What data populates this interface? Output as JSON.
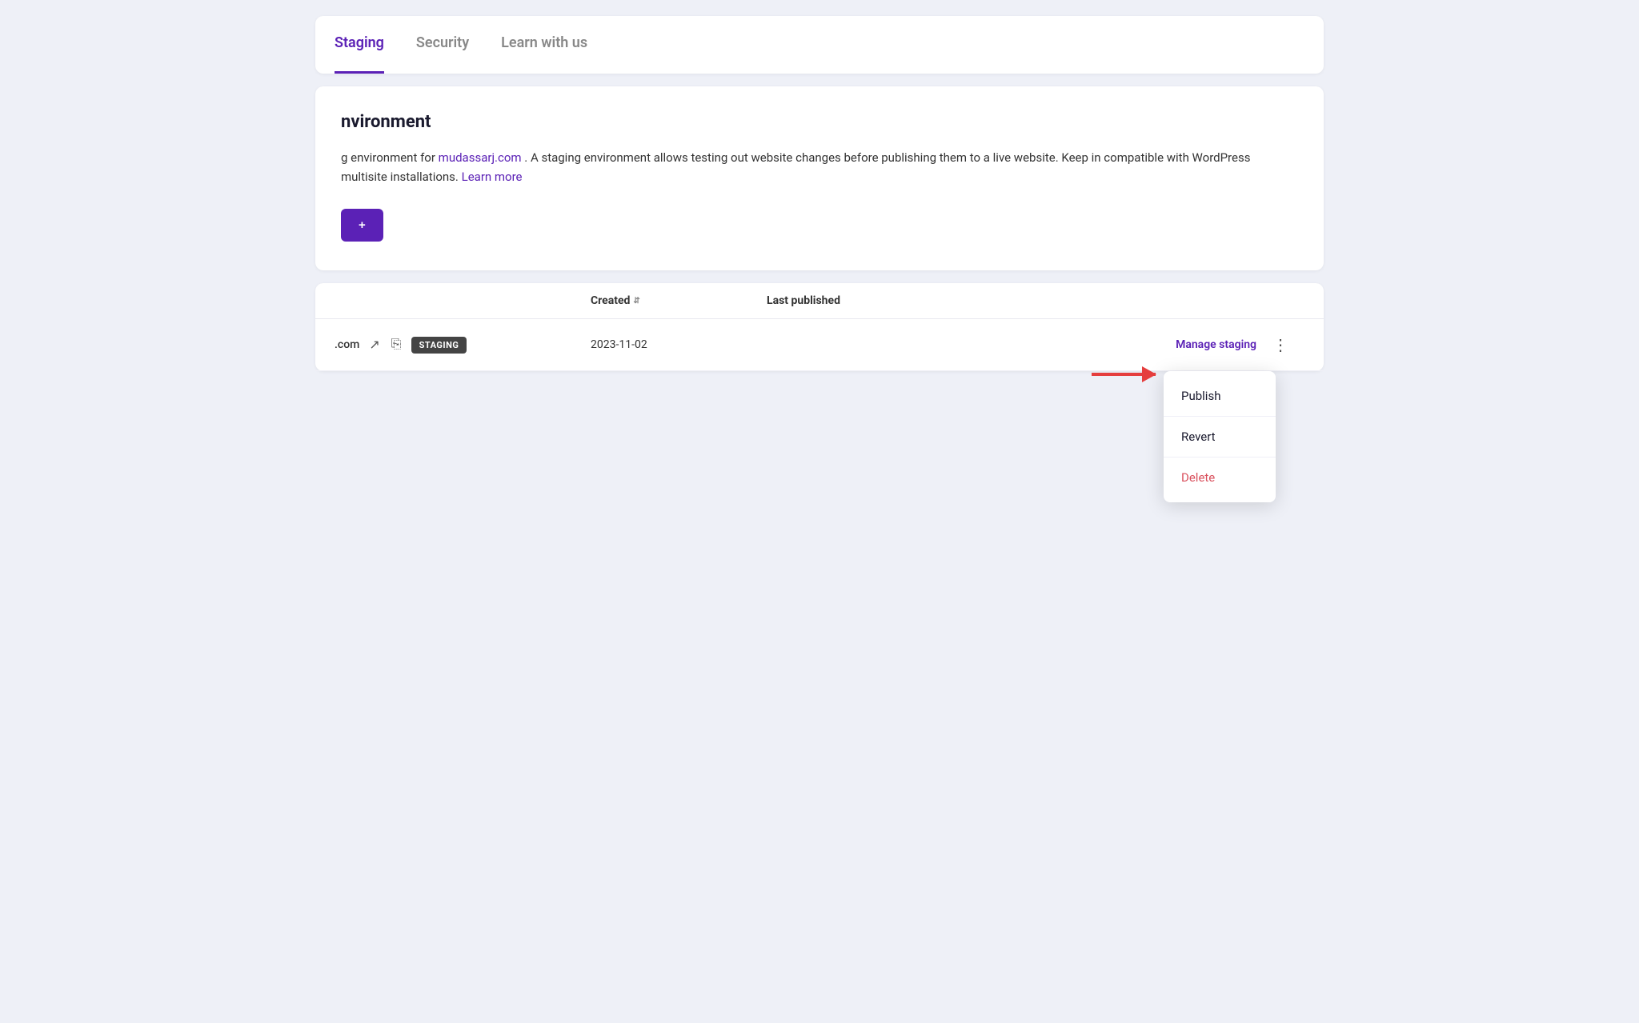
{
  "tabs": {
    "items": [
      {
        "id": "staging",
        "label": "Staging",
        "active": true
      },
      {
        "id": "security",
        "label": "Security",
        "active": false
      },
      {
        "id": "learn",
        "label": "Learn with us",
        "active": false
      }
    ]
  },
  "info_section": {
    "heading": "nvironment",
    "description_prefix": "g environment for ",
    "domain_link": "mudassarj.com",
    "description_suffix": " . A staging environment allows testing out website changes before publishing them to a live website. Keep in compatible with WordPress multisite installations.",
    "learn_more_label": "Learn more",
    "create_button_label": "+"
  },
  "table": {
    "columns": [
      {
        "id": "site",
        "label": ""
      },
      {
        "id": "created",
        "label": "Created",
        "sortable": true
      },
      {
        "id": "last_published",
        "label": "Last published",
        "sortable": false
      },
      {
        "id": "actions",
        "label": ""
      },
      {
        "id": "more",
        "label": ""
      }
    ],
    "rows": [
      {
        "site_name": ".com",
        "badge": "STAGING",
        "created": "2023-11-02",
        "last_published": "",
        "manage_label": "Manage staging"
      }
    ]
  },
  "dropdown": {
    "items": [
      {
        "id": "publish",
        "label": "Publish",
        "color": "default"
      },
      {
        "id": "revert",
        "label": "Revert",
        "color": "default"
      },
      {
        "id": "delete",
        "label": "Delete",
        "color": "delete"
      }
    ]
  }
}
